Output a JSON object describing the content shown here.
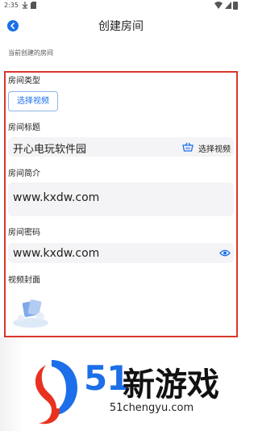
{
  "status_bar": {
    "time": "2:35"
  },
  "header": {
    "title": "创建房间"
  },
  "section_caption": "当前创建的房间",
  "form": {
    "room_type": {
      "label": "房间类型",
      "button_label": "选择视频"
    },
    "room_title": {
      "label": "房间标题",
      "value": "开心电玩软件园",
      "action_label": "选择视频"
    },
    "room_intro": {
      "label": "房间简介",
      "value": "www.kxdw.com"
    },
    "room_password": {
      "label": "房间密码",
      "value": "www.kxdw.com"
    },
    "video_cover": {
      "label": "视频封面"
    }
  },
  "watermark": {
    "brand_number": "51",
    "brand_name": "新游戏",
    "domain": "51chengyu.com"
  },
  "colors": {
    "accent": "#1c6fe8",
    "frame": "#d9362b",
    "field_bg": "#f4f4f6"
  }
}
